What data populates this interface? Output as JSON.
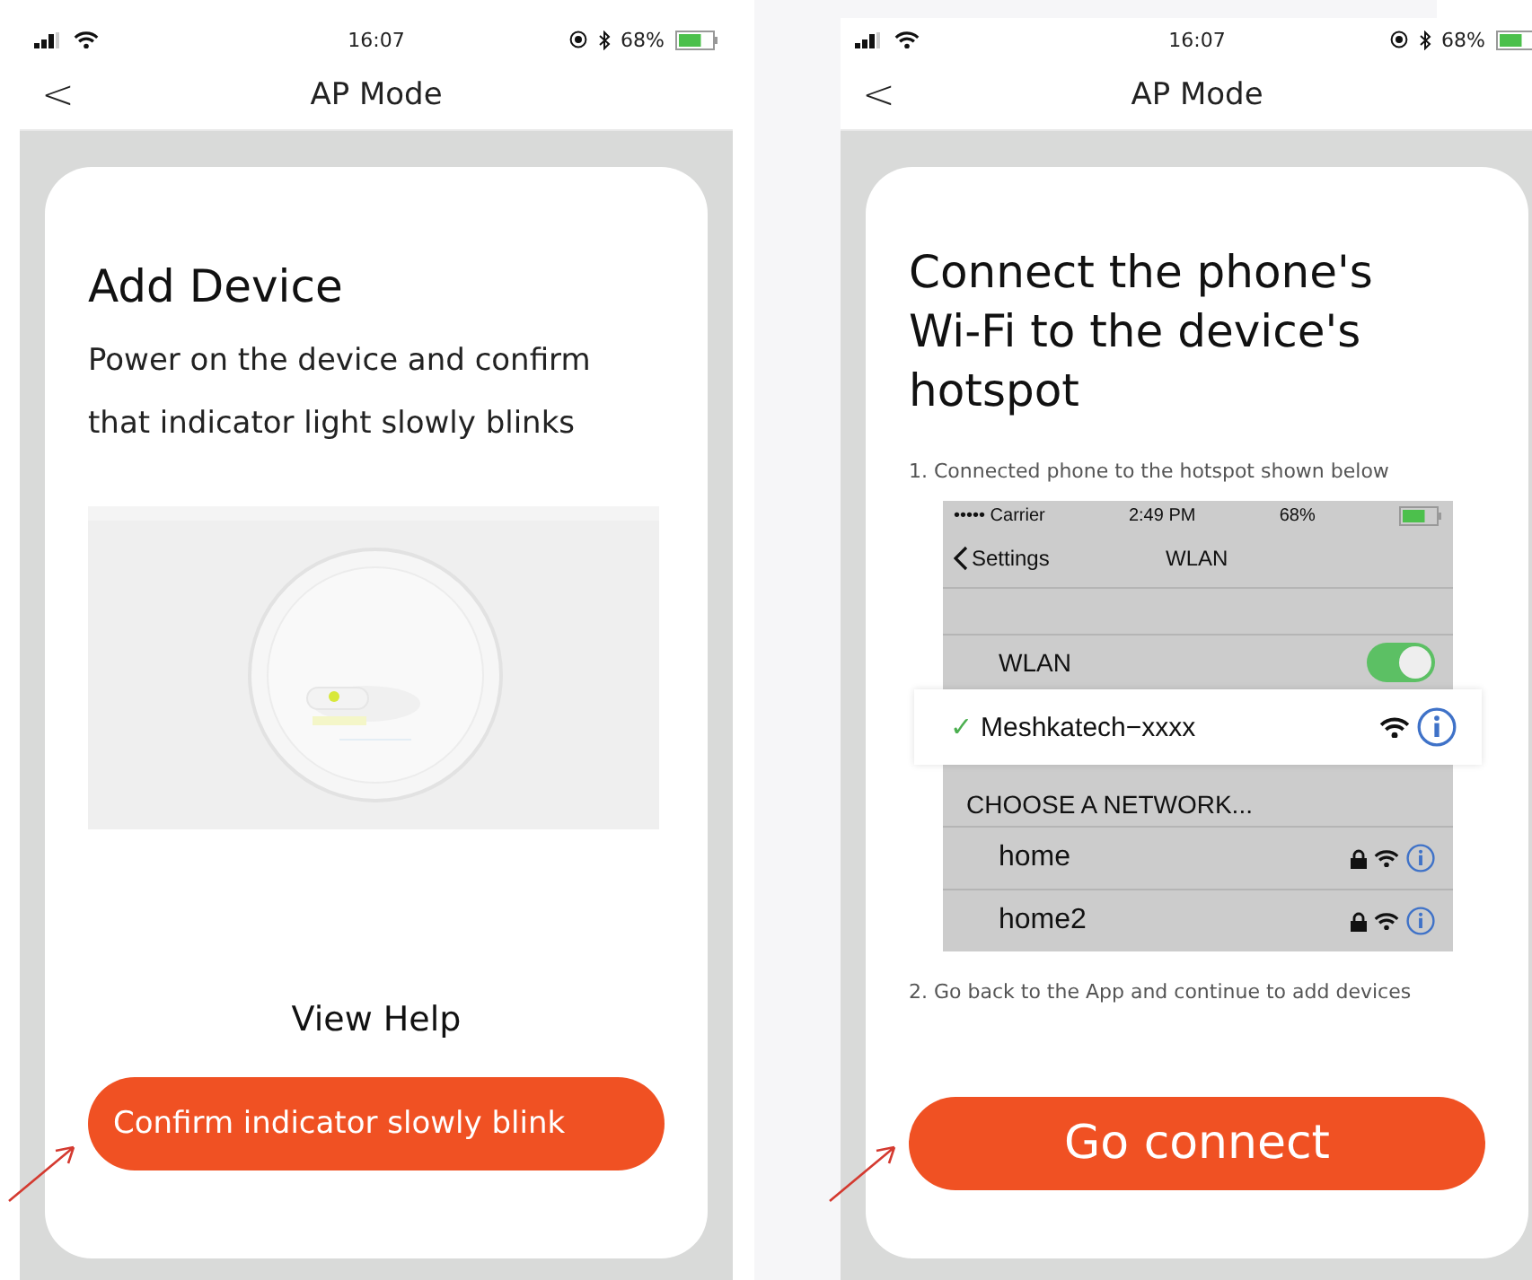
{
  "screens": [
    {
      "kind": "add_device",
      "status": {
        "time": "16:07",
        "battery": "68%"
      },
      "nav": {
        "back": "<",
        "title": "AP Mode"
      },
      "title": "Add Device",
      "description": "Power on the device and confirm that indicator light slowly blinks",
      "help": "View Help",
      "button": "Confirm indicator slowly blink"
    },
    {
      "kind": "connect",
      "status": {
        "time": "16:07",
        "battery": "68%"
      },
      "nav": {
        "back": "<",
        "title": "AP Mode"
      },
      "title": "Connect the phone's Wi-Fi to the device's hotspot",
      "step_1": "1. Connected phone to the hotspot shown below",
      "wifi_screenshot": {
        "status": {
          "carrier": "••••• Carrier",
          "time": "2:49 PM",
          "battery": "68%"
        },
        "back": "Settings",
        "title": "WLAN",
        "wlan": {
          "label": "WLAN",
          "on": true
        },
        "connected": {
          "check": "✓",
          "name": "Meshkatech−xxxx",
          "secured": false
        },
        "section": "CHOOSE A NETWORK...",
        "networks": [
          {
            "name": "home",
            "secured": true
          },
          {
            "name": "home2",
            "secured": true
          }
        ]
      },
      "step_2": "2. Go back to the App and continue to add devices",
      "button": "Go connect"
    }
  ]
}
